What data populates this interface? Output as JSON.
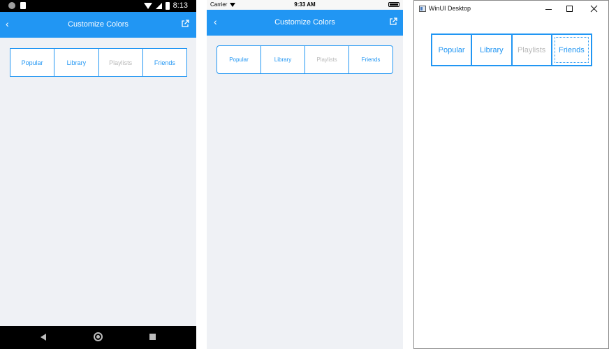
{
  "android": {
    "status_time": "8:13",
    "title": "Customize Colors",
    "segments": [
      "Popular",
      "Library",
      "Playlists",
      "Friends"
    ],
    "disabled_segment": "Playlists"
  },
  "ios": {
    "carrier": "Carrier",
    "status_time": "9:33 AM",
    "title": "Customize Colors",
    "segments": [
      "Popular",
      "Library",
      "Playlists",
      "Friends"
    ],
    "disabled_segment": "Playlists"
  },
  "winui": {
    "window_title": "WinUI Desktop",
    "segments": [
      "Popular",
      "Library",
      "Playlists",
      "Friends"
    ],
    "disabled_segment": "Playlists",
    "focused_segment": "Friends"
  },
  "colors": {
    "accent": "#2196f3",
    "page_background": "#eff1f5",
    "disabled_text": "#b9b9b9"
  },
  "icons": [
    "back-chevron-icon",
    "open-external-icon",
    "wifi-icon",
    "battery-icon",
    "minimize-icon",
    "maximize-icon",
    "close-icon"
  ]
}
